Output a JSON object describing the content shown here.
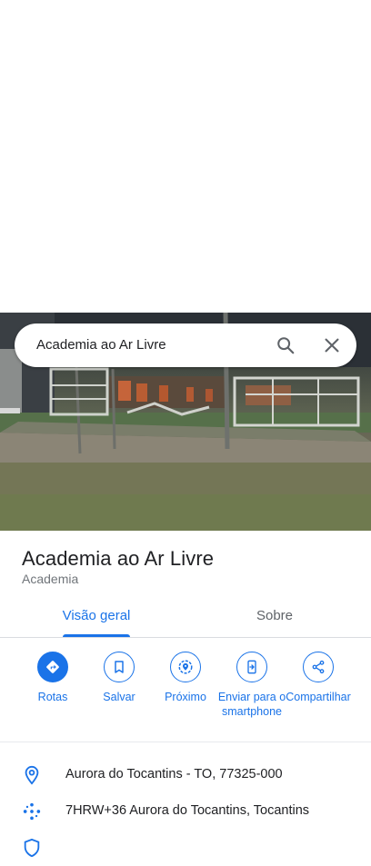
{
  "search": {
    "query": "Academia ao Ar Livre"
  },
  "place": {
    "title": "Academia ao Ar Livre",
    "category": "Academia"
  },
  "tabs": [
    {
      "label": "Visão geral",
      "selected": true
    },
    {
      "label": "Sobre",
      "selected": false
    }
  ],
  "actions": [
    {
      "label": "Rotas",
      "icon": "directions-icon"
    },
    {
      "label": "Salvar",
      "icon": "bookmark-icon"
    },
    {
      "label": "Próximo",
      "icon": "nearby-icon"
    },
    {
      "label": "Enviar para o smartphone",
      "icon": "send-to-phone-icon"
    },
    {
      "label": "Compartilhar",
      "icon": "share-icon"
    }
  ],
  "info": {
    "address": "Aurora do Tocantins - TO, 77325-000",
    "plus_code": "7HRW+36 Aurora do Tocantins, Tocantins"
  },
  "colors": {
    "accent": "#1a73e8",
    "text": "#202124",
    "secondary": "#70757a"
  }
}
